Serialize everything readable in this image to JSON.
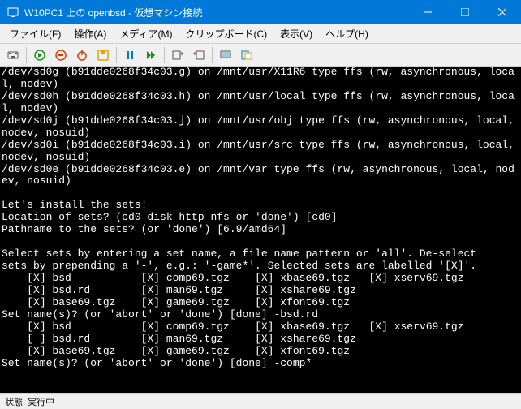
{
  "window": {
    "title": "W10PC1 上の openbsd - 仮想マシン接続"
  },
  "menu": {
    "file": "ファイル(F)",
    "action": "操作(A)",
    "media": "メディア(M)",
    "clipboard": "クリップボード(C)",
    "view": "表示(V)",
    "help": "ヘルプ(H)"
  },
  "status": {
    "label": "状態:",
    "value": "実行中"
  },
  "terminal_lines": [
    "/dev/sd0g (b91dde0268f34c03.g) on /mnt/usr/X11R6 type ffs (rw, asynchronous, local, nodev)",
    "/dev/sd0h (b91dde0268f34c03.h) on /mnt/usr/local type ffs (rw, asynchronous, local, nodev)",
    "/dev/sd0j (b91dde0268f34c03.j) on /mnt/usr/obj type ffs (rw, asynchronous, local, nodev, nosuid)",
    "/dev/sd0i (b91dde0268f34c03.i) on /mnt/usr/src type ffs (rw, asynchronous, local, nodev, nosuid)",
    "/dev/sd0e (b91dde0268f34c03.e) on /mnt/var type ffs (rw, asynchronous, local, nodev, nosuid)",
    "",
    "Let's install the sets!",
    "Location of sets? (cd0 disk http nfs or 'done') [cd0]",
    "Pathname to the sets? (or 'done') [6.9/amd64]",
    "",
    "Select sets by entering a set name, a file name pattern or 'all'. De-select",
    "sets by prepending a '-', e.g.: '-game*'. Selected sets are labelled '[X]'.",
    "    [X] bsd           [X] comp69.tgz    [X] xbase69.tgz   [X] xserv69.tgz",
    "    [X] bsd.rd        [X] man69.tgz     [X] xshare69.tgz",
    "    [X] base69.tgz    [X] game69.tgz    [X] xfont69.tgz",
    "Set name(s)? (or 'abort' or 'done') [done] -bsd.rd",
    "    [X] bsd           [X] comp69.tgz    [X] xbase69.tgz   [X] xserv69.tgz",
    "    [ ] bsd.rd        [X] man69.tgz     [X] xshare69.tgz",
    "    [X] base69.tgz    [X] game69.tgz    [X] xfont69.tgz",
    "Set name(s)? (or 'abort' or 'done') [done] -comp*"
  ]
}
